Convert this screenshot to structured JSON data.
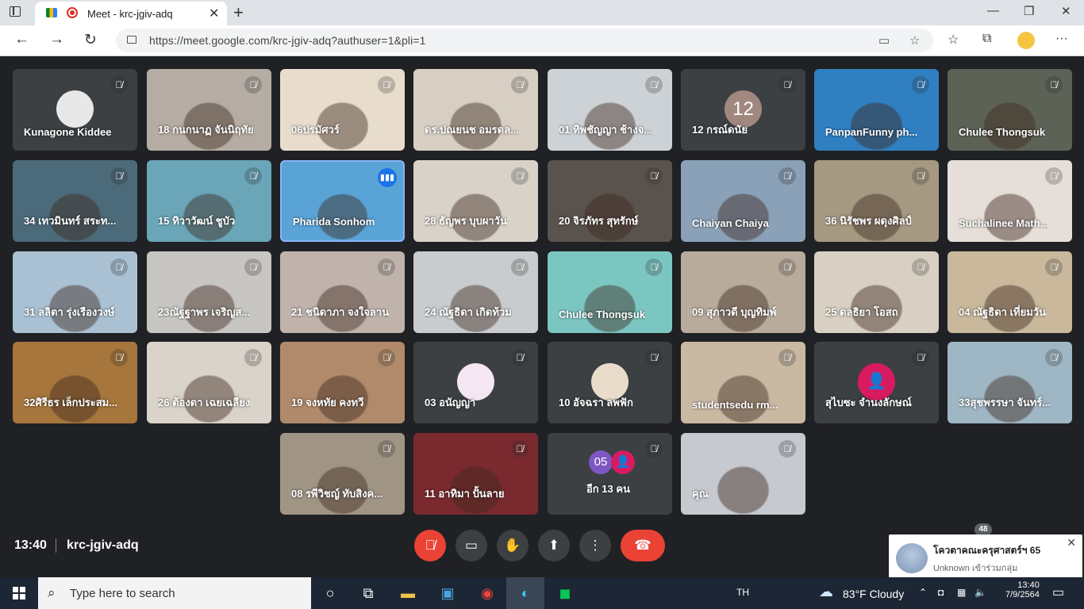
{
  "browser": {
    "tab_title": "Meet - krc-jgiv-adq",
    "url": "https://meet.google.com/krc-jgiv-adq?authuser=1&pli=1"
  },
  "participants": [
    {
      "name": "Kunagone Kiddee",
      "bg": "#3c4043",
      "avatar": ""
    },
    {
      "name": "18 กนกนาฏ จันนิฤทัย",
      "bg": "#b5ada3",
      "avatar": ""
    },
    {
      "name": "06ปรมัศวร์",
      "bg": "#e8ddcc",
      "avatar": ""
    },
    {
      "name": "ดร.ปณยนช อมรดล...",
      "bg": "#d7cfc3",
      "avatar": ""
    },
    {
      "name": "01 ทิพชัญญา ช้างจ...",
      "bg": "#cdd2d6",
      "avatar": ""
    },
    {
      "name": "12 กรณ์ดนัย",
      "bg": "#3c4043",
      "avatar": "12"
    },
    {
      "name": "PanpanFunny ph...",
      "bg": "#2f7fc1",
      "avatar": ""
    },
    {
      "name": "Chulee Thongsuk",
      "bg": "#5d6256",
      "avatar": ""
    },
    {
      "name": "34 เทวมินทร์ สระท...",
      "bg": "#4b6a7a",
      "avatar": ""
    },
    {
      "name": "15 ทิวาวัฒน์ ชูบัว",
      "bg": "#6aa5b8",
      "avatar": ""
    },
    {
      "name": "Pharida Sonhom",
      "bg": "#5aa3d6",
      "avatar": ""
    },
    {
      "name": "28 ธัญพร บุบผาวัน",
      "bg": "#d9d2c8",
      "avatar": ""
    },
    {
      "name": "20 จิรภัทร สุทรักษ์",
      "bg": "#5a524c",
      "avatar": ""
    },
    {
      "name": "Chaiyan Chaiya",
      "bg": "#8aa1b8",
      "avatar": ""
    },
    {
      "name": "36 นิรัชพร ผดุงศิลป์",
      "bg": "#a69982",
      "avatar": ""
    },
    {
      "name": "Suchalinee Math...",
      "bg": "#e6dfd9",
      "avatar": ""
    },
    {
      "name": "31 ลลิตา รุ่งเรืองวงษ์",
      "bg": "#a9c1d3",
      "avatar": ""
    },
    {
      "name": "23ณัฐฐาพร เจริญส...",
      "bg": "#c8c6c2",
      "avatar": ""
    },
    {
      "name": "21 ชนิดาภา จงใจลาน",
      "bg": "#bfb3ac",
      "avatar": ""
    },
    {
      "name": "24 ณัฐธิดา เกิดท้วม",
      "bg": "#c9ccce",
      "avatar": ""
    },
    {
      "name": "Chulee Thongsuk",
      "bg": "#7cc6c2",
      "avatar": ""
    },
    {
      "name": "09 สุภาวดี บุญทิมพ์",
      "bg": "#b8ab9c",
      "avatar": ""
    },
    {
      "name": "25 ดลธิยา โอสถ",
      "bg": "#d8d0c2",
      "avatar": ""
    },
    {
      "name": "04 ณัฐธิดา เที่ยมวัน",
      "bg": "#c9b89c",
      "avatar": ""
    },
    {
      "name": "32ศิรีธร เล็กประสม...",
      "bg": "#a6763c",
      "avatar": ""
    },
    {
      "name": "26 ต้องตา เฉยเฉลียง",
      "bg": "#d9d3c9",
      "avatar": ""
    },
    {
      "name": "19 จงหทัย คงทวี",
      "bg": "#b08a6a",
      "avatar": ""
    },
    {
      "name": "03 อนัญญา",
      "bg": "#3c4043",
      "avatar": "kuromi"
    },
    {
      "name": "10 อัจฉรา ลพฟัก",
      "bg": "#3c4043",
      "avatar": "photo"
    },
    {
      "name": "studentsedu rm...",
      "bg": "#c9b9a3",
      "avatar": ""
    },
    {
      "name": "สุไบซะ จำนงลักษณ์",
      "bg": "#3c4043",
      "avatar": "person"
    },
    {
      "name": "33สุชพรรษา จันทร์...",
      "bg": "#9fb6c4",
      "avatar": ""
    },
    {
      "name": "08 รพีวิชญ์ ทับสิงค...",
      "bg": "#a09585",
      "avatar": ""
    },
    {
      "name": "11 อาทิมา ปั้นลาย",
      "bg": "#7a2a2e",
      "avatar": ""
    },
    {
      "name": "อีก 13 คน",
      "bg": "#3c4043",
      "avatar": "group"
    },
    {
      "name": "คุณ",
      "bg": "#c6c9cf",
      "avatar": ""
    }
  ],
  "group_tile": {
    "avatar_label": "05"
  },
  "bottom": {
    "time": "13:40",
    "meeting_code": "krc-jgiv-adq",
    "participant_count": "48"
  },
  "notification": {
    "title": "โควตาคณะครุศาสตร์ฯ 65",
    "subtitle": "Unknown เข้าร่วมกลุ่ม"
  },
  "taskbar": {
    "search_placeholder": "Type here to search",
    "language": "TH",
    "weather": "83°F  Cloudy",
    "time": "13:40",
    "date": "7/9/2564"
  }
}
